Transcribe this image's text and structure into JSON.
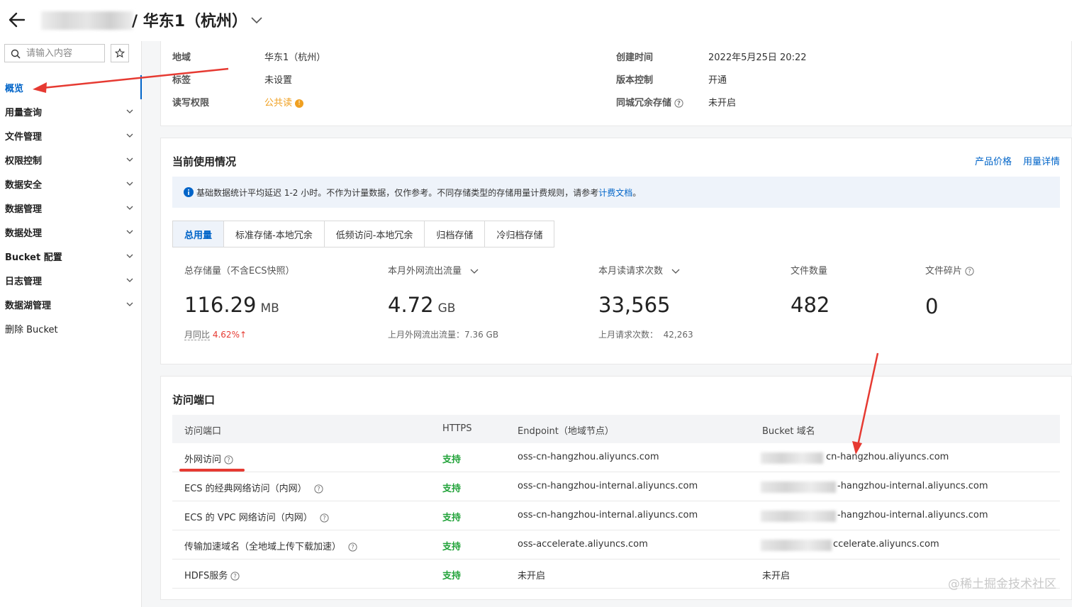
{
  "header": {
    "title": "/ 华东1（杭州）"
  },
  "sidebar": {
    "search_placeholder": "请输入内容",
    "items": [
      {
        "label": "概览",
        "active": true,
        "expandable": false
      },
      {
        "label": "用量查询",
        "expandable": true
      },
      {
        "label": "文件管理",
        "expandable": true
      },
      {
        "label": "权限控制",
        "expandable": true
      },
      {
        "label": "数据安全",
        "expandable": true
      },
      {
        "label": "数据管理",
        "expandable": true
      },
      {
        "label": "数据处理",
        "expandable": true
      },
      {
        "label": "Bucket 配置",
        "expandable": true
      },
      {
        "label": "日志管理",
        "expandable": true
      },
      {
        "label": "数据湖管理",
        "expandable": true
      },
      {
        "label": "删除 Bucket",
        "expandable": false
      }
    ]
  },
  "info": {
    "region_label": "地域",
    "region_value": "华东1（杭州）",
    "tag_label": "标签",
    "tag_value": "未设置",
    "acl_label": "读写权限",
    "acl_value": "公共读",
    "created_label": "创建时间",
    "created_value": "2022年5月25日 20:22",
    "versioning_label": "版本控制",
    "versioning_value": "开通",
    "zrs_label": "同城冗余存储",
    "zrs_value": "未开启"
  },
  "usage": {
    "title": "当前使用情况",
    "link_price": "产品价格",
    "link_detail": "用量详情",
    "notice_text": "基础数据统计平均延迟 1-2 小时。不作为计量数据，仅作参考。不同存储类型的存储用量计费规则，请参考",
    "notice_link": "计费文档",
    "notice_end": "。",
    "tabs": [
      "总用量",
      "标准存储-本地冗余",
      "低频访问-本地冗余",
      "归档存储",
      "冷归档存储"
    ],
    "storage": {
      "label": "总存储量（不含ECS快照）",
      "value": "116.29",
      "unit": "MB",
      "mom_label": "月同比",
      "mom_value": "4.62%",
      "mom_arrow": "↑"
    },
    "traffic": {
      "label": "本月外网流出流量",
      "value": "4.72",
      "unit": "GB",
      "sub": "上月外网流出流量：7.36 GB"
    },
    "requests": {
      "label": "本月读请求次数",
      "value": "33,565",
      "sub_label": "上月请求次数：",
      "sub_value": "42,263"
    },
    "files": {
      "label": "文件数量",
      "value": "482"
    },
    "fragments": {
      "label": "文件碎片",
      "value": "0"
    }
  },
  "endpoints": {
    "title": "访问端口",
    "columns": [
      "访问端口",
      "HTTPS",
      "Endpoint（地域节点）",
      "Bucket 域名"
    ],
    "rows": [
      {
        "name": "外网访问",
        "https": "支持",
        "endpoint": "oss-cn-hangzhou.aliyuncs.com",
        "domain": "cn-hangzhou.aliyuncs.com"
      },
      {
        "name": "ECS 的经典网络访问（内网）",
        "https": "支持",
        "endpoint": "oss-cn-hangzhou-internal.aliyuncs.com",
        "domain": "-hangzhou-internal.aliyuncs.com"
      },
      {
        "name": "ECS 的 VPC 网络访问（内网）",
        "https": "支持",
        "endpoint": "oss-cn-hangzhou-internal.aliyuncs.com",
        "domain": "-hangzhou-internal.aliyuncs.com"
      },
      {
        "name": "传输加速域名（全地域上传下载加速）",
        "https": "支持",
        "endpoint": "oss-accelerate.aliyuncs.com",
        "domain": "ccelerate.aliyuncs.com"
      },
      {
        "name": "HDFS服务",
        "https": "支持",
        "endpoint": "未开启",
        "domain": "未开启"
      }
    ]
  },
  "watermark": "@稀土掘金技术社区",
  "colors": {
    "accent": "#0064c8",
    "success": "#22a33a",
    "warning": "#f0a020",
    "danger": "#e63a32"
  }
}
